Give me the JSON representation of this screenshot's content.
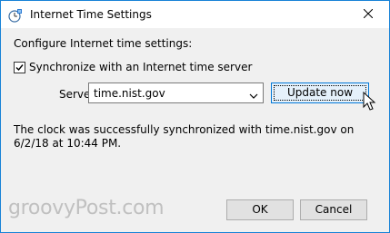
{
  "window": {
    "title": "Internet Time Settings"
  },
  "main": {
    "heading": "Configure Internet time settings:",
    "sync_checkbox": {
      "label": "Synchronize with an Internet time server",
      "checked": true
    },
    "server": {
      "label": "Server:",
      "selected": "time.nist.gov"
    },
    "update_button": "Update now",
    "status_text": "The clock was successfully synchronized with time.nist.gov on 6/2/18 at 10:44 PM."
  },
  "footer": {
    "ok_label": "OK",
    "cancel_label": "Cancel"
  },
  "watermark": "groovyPost.com",
  "icons": {
    "title": "internet-time-icon",
    "close": "close-icon",
    "dropdown": "chevron-down-icon",
    "cursor": "mouse-pointer-icon"
  },
  "colors": {
    "accent_border": "#1883d7",
    "focus_button_bg": "#e5f1fb",
    "focus_button_border": "#0078d7"
  }
}
